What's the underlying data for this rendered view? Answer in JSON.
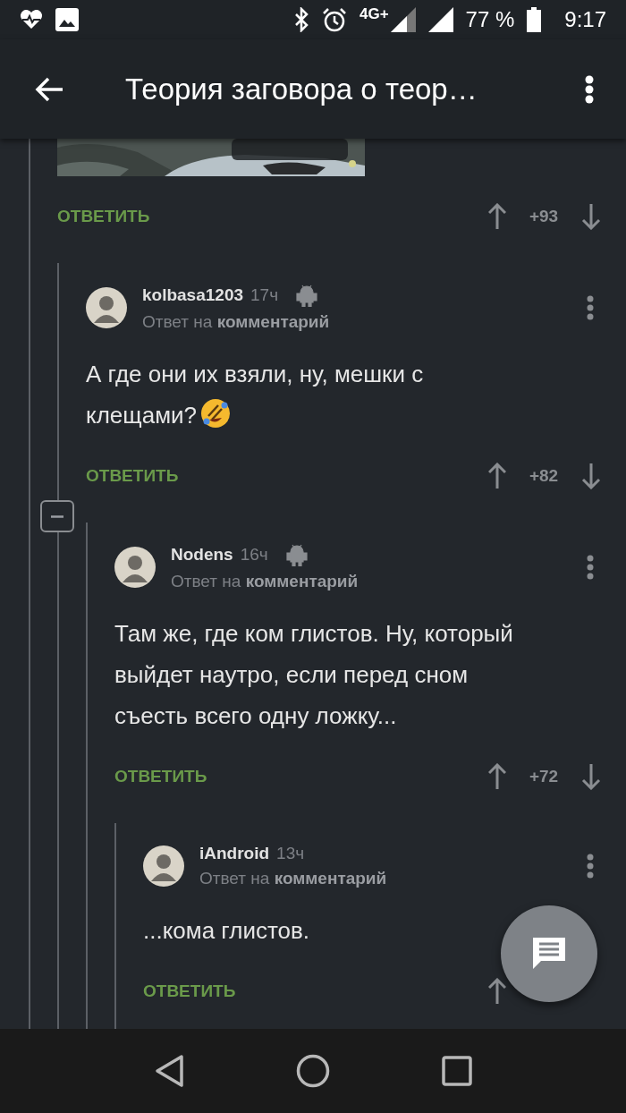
{
  "status_bar": {
    "network": "4G+",
    "battery": "77 %",
    "time": "9:17"
  },
  "app_bar": {
    "title": "Теория заговора о теор…"
  },
  "thread": {
    "collapse_toggle": {
      "expanded": true
    },
    "comments": [
      {
        "kind": "media",
        "reply_label": "ОТВЕТИТЬ",
        "score": "+93",
        "children": [
          {
            "kind": "text",
            "author": "kolbasa1203",
            "time": "17ч",
            "app_badge": true,
            "reply_to": "Ответ на **комментарий**",
            "text": "А где они их взяли, ну, мешки с клещами?",
            "emoji": true,
            "reply_label": "ОТВЕТИТЬ",
            "score": "+82",
            "children": [
              {
                "kind": "text",
                "author": "Nodens",
                "time": "16ч",
                "app_badge": true,
                "reply_to": "Ответ на **комментарий**",
                "text": "Там же, где ком глистов. Ну, который выйдет наутро, если перед сном съесть всего одну ложку...",
                "reply_label": "ОТВЕТИТЬ",
                "score": "+72",
                "children": [
                  {
                    "kind": "text",
                    "author": "iAndroid",
                    "time": "13ч",
                    "reply_to": "Ответ на **комментарий**",
                    "text": "...кома глистов.",
                    "reply_label": "ОТВЕТИТЬ"
                  }
                ]
              }
            ]
          }
        ]
      }
    ]
  }
}
